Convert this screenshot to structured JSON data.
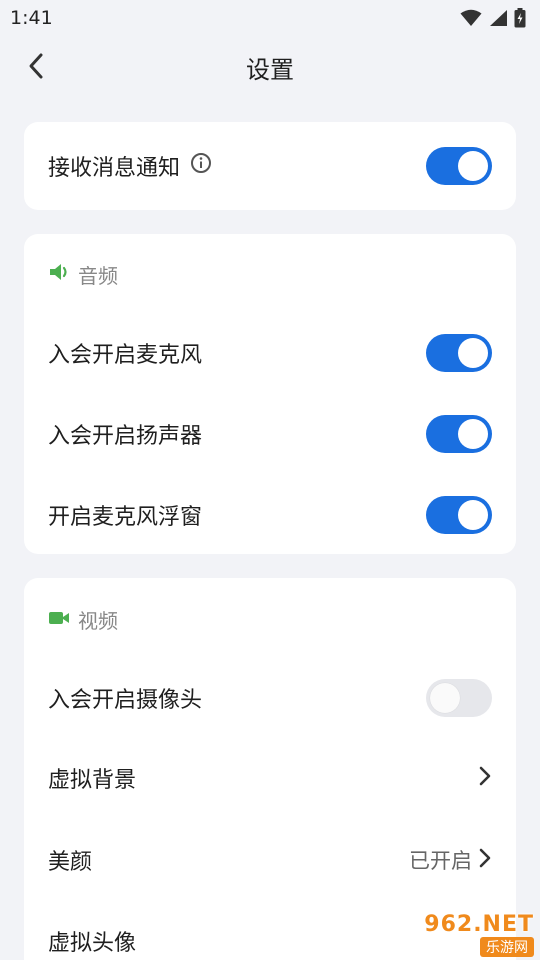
{
  "status_bar": {
    "time": "1:41",
    "icons": [
      "wifi-icon",
      "signal-icon",
      "battery-charging-icon"
    ]
  },
  "header": {
    "title": "设置",
    "back_icon": "chevron-left-icon"
  },
  "notifications": {
    "label": "接收消息通知",
    "info_icon": "info-icon",
    "enabled": true
  },
  "audio": {
    "section_label": "音频",
    "section_icon": "speaker-icon",
    "items": [
      {
        "label": "入会开启麦克风",
        "enabled": true
      },
      {
        "label": "入会开启扬声器",
        "enabled": true
      },
      {
        "label": "开启麦克风浮窗",
        "enabled": true
      }
    ]
  },
  "video": {
    "section_label": "视频",
    "section_icon": "video-camera-icon",
    "camera": {
      "label": "入会开启摄像头",
      "enabled": false
    },
    "virtual_background": {
      "label": "虚拟背景"
    },
    "beauty": {
      "label": "美颜",
      "value": "已开启"
    },
    "virtual_avatar": {
      "label": "虚拟头像"
    }
  },
  "watermark": {
    "top": "962.NET",
    "bottom": "乐游网"
  },
  "colors": {
    "accent": "#1A6FE0",
    "section_icon": "#4CAF50",
    "background": "#F2F3F7",
    "card": "#FFFFFF"
  }
}
